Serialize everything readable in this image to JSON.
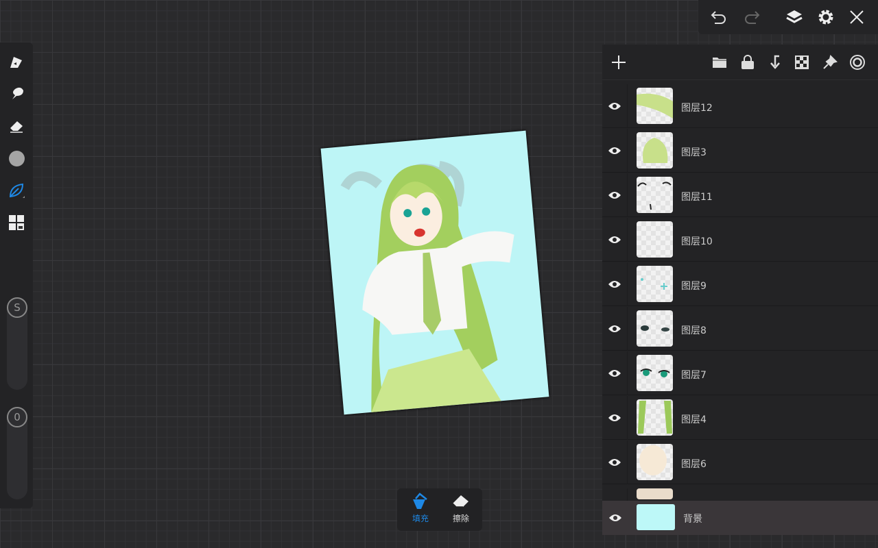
{
  "top_bar": {
    "icons": [
      "undo-icon",
      "redo-icon",
      "layers-icon",
      "gear-icon",
      "close-icon"
    ]
  },
  "layers_panel": {
    "header_icons": [
      "plus-icon",
      "folder-icon",
      "lock-icon",
      "merge-down-icon",
      "checker-icon",
      "pin-icon",
      "target-icon"
    ],
    "layers": [
      {
        "name": "图层12",
        "thumb": "hair"
      },
      {
        "name": "图层3",
        "thumb": "hair2"
      },
      {
        "name": "图层11",
        "thumb": "lines"
      },
      {
        "name": "图层10",
        "thumb": "empty"
      },
      {
        "name": "图层9",
        "thumb": "sparkle"
      },
      {
        "name": "图层8",
        "thumb": "shadow"
      },
      {
        "name": "图层7",
        "thumb": "eyes"
      },
      {
        "name": "图层4",
        "thumb": "hairside"
      },
      {
        "name": "图层6",
        "thumb": "skin"
      }
    ],
    "background_layer": {
      "name": "背景",
      "color": "#bdf8f8"
    }
  },
  "left_toolbar": {
    "size_label": "S",
    "opacity_label": "0",
    "active_color": "#1e88e5"
  },
  "bottom_tools": {
    "fill_label": "填充",
    "erase_label": "擦除"
  }
}
